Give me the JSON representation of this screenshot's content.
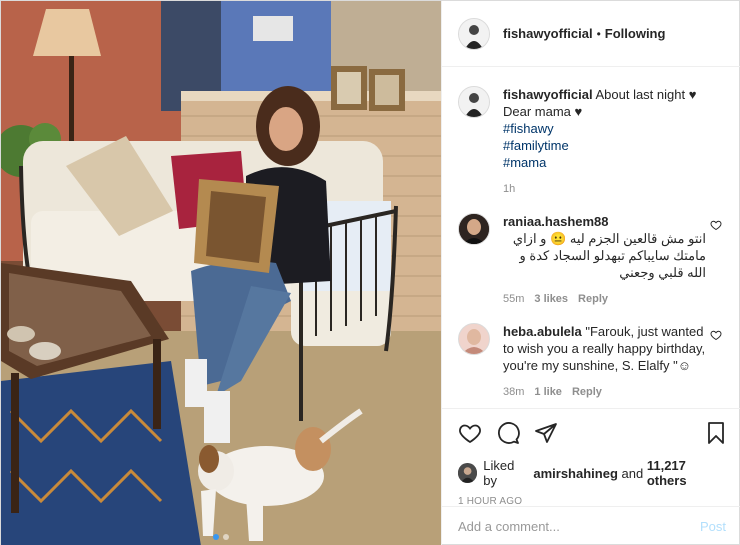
{
  "header": {
    "username": "fishawyofficial",
    "separator": "•",
    "follow_status": "Following"
  },
  "caption": {
    "username": "fishawyofficial",
    "text": "About last night ♥ Dear mama ♥",
    "hashtags": [
      "#fishawy",
      "#familytime",
      "#mama"
    ],
    "age": "1h"
  },
  "comments": [
    {
      "username": "raniaa.hashem88",
      "text": "انتو مش قالعين الجزم ليه 😐 و ازاي مامتك سايباكم تبهدلو السجاد كدة و الله قلبي وجعني",
      "age": "55m",
      "likes": "3 likes",
      "reply": "Reply"
    },
    {
      "username": "heba.abulela",
      "text": "\"Farouk, just wanted to wish you a really happy birthday, you're my sunshine, S. Elalfy \"☺",
      "age": "38m",
      "likes": "1 like",
      "reply": "Reply"
    }
  ],
  "likes": {
    "prefix": "Liked by",
    "user": "amirshahineg",
    "joiner": "and",
    "others": "11,217 others"
  },
  "timestamp": "1 HOUR AGO",
  "add_comment": {
    "placeholder": "Add a comment...",
    "post_label": "Post"
  },
  "icons": {
    "like": "heart-icon",
    "comment": "comment-icon",
    "share": "share-icon",
    "save": "bookmark-icon"
  },
  "carousel": {
    "slides": 2,
    "active": 1
  },
  "colors": {
    "link": "#003569",
    "muted": "#8e8e8e",
    "post_disabled": "#b2dffc",
    "dot_active": "#3897f0"
  }
}
